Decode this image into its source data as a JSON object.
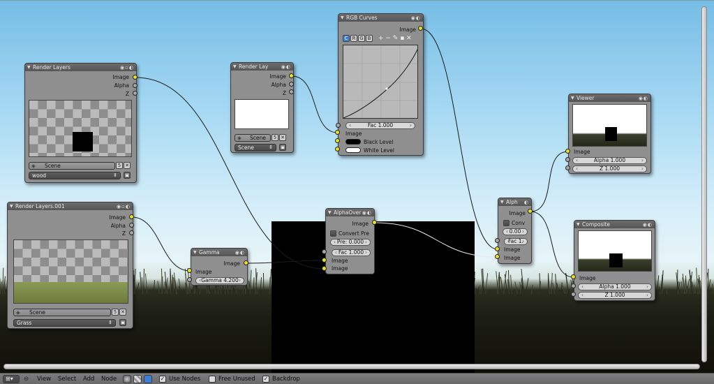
{
  "nodes": {
    "render_layers": {
      "title": "Render Layers",
      "outputs": [
        "Image",
        "Alpha",
        "Z"
      ],
      "scene": "Scene",
      "scene_users": "5",
      "layer": "wood"
    },
    "render_lay": {
      "title": "Render Lay",
      "outputs": [
        "Image",
        "Alpha",
        "Z"
      ],
      "scene": "Scene",
      "scene_users": "5",
      "layer": "Scene"
    },
    "rgb_curves": {
      "title": "RGB Curves",
      "output": "Image",
      "channels": [
        "C",
        "R",
        "G",
        "B"
      ],
      "fac": "Fac 1.000",
      "inputs": [
        "Image",
        "Black Level",
        "White Level"
      ]
    },
    "render_layers_001": {
      "title": "Render Layers.001",
      "outputs": [
        "Image",
        "Alpha",
        "Z"
      ],
      "scene": "Scene",
      "scene_users": "5",
      "layer": "Grass"
    },
    "gamma": {
      "title": "Gamma",
      "output": "Image",
      "input": "Image",
      "gamma": "Gamma 4.200"
    },
    "alpha_over": {
      "title": "AlphaOver",
      "output": "Image",
      "convert": "Convert Pre",
      "pre": "Pre: 0.000",
      "fac": "Fac 1.000",
      "inputs": [
        "Image",
        "Image"
      ]
    },
    "alph": {
      "title": "Alph",
      "output": "Image",
      "conv": "Conv",
      "value": "0.00",
      "fac": "Fac 1.",
      "inputs": [
        "Image",
        "Image"
      ]
    },
    "viewer": {
      "title": "Viewer",
      "input": "Image",
      "alpha": "Alpha 1.000",
      "z": "Z 1.000"
    },
    "composite": {
      "title": "Composite",
      "input": "Image",
      "alpha": "Alpha 1.000",
      "z": "Z 1.000"
    }
  },
  "header": {
    "menus": [
      "View",
      "Select",
      "Add",
      "Node"
    ],
    "use_nodes": "Use Nodes",
    "free_unused": "Free Unused",
    "backdrop": "Backdrop"
  },
  "colors": {
    "socket_color": "#e8e028",
    "socket_grey": "#a8a8a8",
    "node_body": "#8f8f8f",
    "node_header": "#5f5f5f",
    "active_channel": "#3b7fd6"
  },
  "icons": {
    "node_header_buttons": "node-toggle-icons",
    "editor_type": "node-editor-icon",
    "collapse": "collapse-triangle-icon"
  }
}
